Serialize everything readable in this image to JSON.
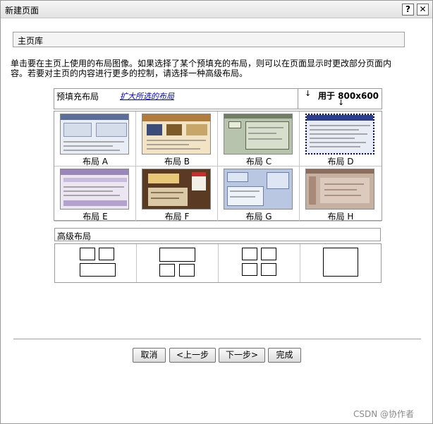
{
  "window": {
    "title": "新建页面",
    "help_label": "?",
    "close_label": "✕"
  },
  "library": {
    "value": "主页库"
  },
  "instructions": "单击要在主页上使用的布局图像。如果选择了某个预填充的布局，则可以在页面显示时更改部分页面内容。若要对主页的内容进行更多的控制，请选择一种高级布局。",
  "layouts_header": {
    "prefill_label": "预填充布局",
    "expand_link": "扩大所选的布局",
    "resolution_label": "用于 800x600",
    "arrow_glyph": "↓"
  },
  "layouts": [
    {
      "label": "布局 A",
      "selected": false
    },
    {
      "label": "布局 B",
      "selected": false
    },
    {
      "label": "布局 C",
      "selected": false
    },
    {
      "label": "布局 D",
      "selected": true
    },
    {
      "label": "布局 E",
      "selected": false
    },
    {
      "label": "布局 F",
      "selected": false
    },
    {
      "label": "布局 G",
      "selected": false
    },
    {
      "label": "布局 H",
      "selected": false
    }
  ],
  "advanced": {
    "label": "高级布局"
  },
  "buttons": {
    "cancel": "取消",
    "prev": "<上一步",
    "next": "下一步>",
    "finish": "完成"
  },
  "watermark": "CSDN @协作者"
}
